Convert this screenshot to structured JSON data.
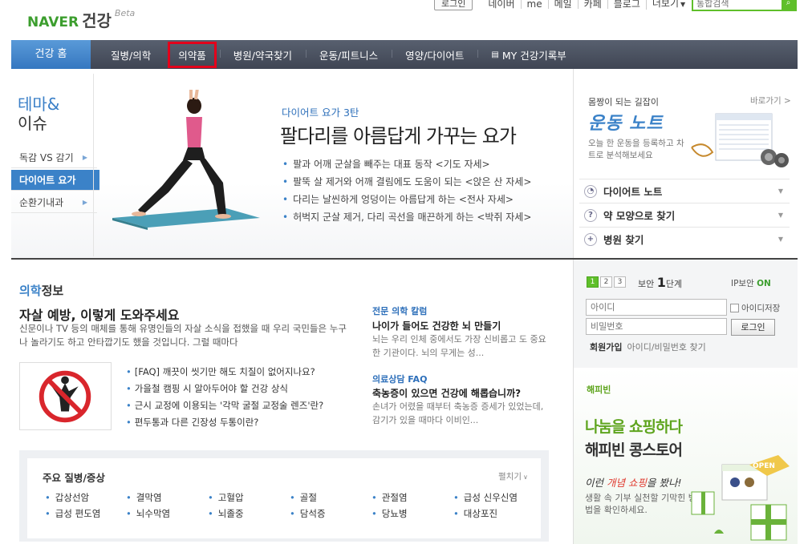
{
  "header": {
    "logo_naver": "NAVER",
    "logo_service": "건강",
    "logo_beta": "Beta",
    "login_button": "로그인",
    "top_links": [
      "네이버",
      "me",
      "메일",
      "카페",
      "블로그",
      "더보기"
    ],
    "search_placeholder": "통합검색"
  },
  "gnb": {
    "home": "건강 홈",
    "items": [
      "질병/의학",
      "의약품",
      "병원/약국찾기",
      "운동/피트니스",
      "영양/다이어트",
      "MY 건강기록부"
    ],
    "selected": "의약품"
  },
  "theme": {
    "title_line1": "테마&",
    "title_line2": "이슈",
    "menu": [
      "독감 VS 감기",
      "다이어트 요가",
      "순환기내과"
    ],
    "active_menu": "다이어트 요가",
    "subtitle": "다이어트 요가 3탄",
    "headline": "팔다리를 아름답게 가꾸는 요가",
    "bullets": [
      "팔과 어깨 군살을 빼주는 대표 동작 <기도 자세>",
      "팔뚝 살 제거와 어깨 결림에도 도움이 되는 <앉은 산 자세>",
      "다리는 날씬하게 엉덩이는 아름답게 하는 <전사 자세>",
      "허벅지 군살 제거, 다리 곡선을 매끈하게 하는 <박쥐 자세>"
    ]
  },
  "exercise_note": {
    "line1": "몸짱이 되는 길잡이",
    "title": "운동 노트",
    "desc": "오늘 한 운동을 등록하고 차트로 분석해보세요",
    "more": "바로가기 >",
    "rows": [
      "다이어트 노트",
      "약 모양으로 찾기",
      "병원 찾기"
    ]
  },
  "medical": {
    "title_highlight": "의학",
    "title_rest": "정보",
    "headline": "자살 예방, 이렇게 도와주세요",
    "desc": "신문이나 TV 등의 매체를 통해 유명인들의 자살 소식을 접했을 때 우리 국민들은 누구나 놀라기도 하고 안타깝기도 했을 것입니다. 그럴 때마다",
    "links": [
      "[FAQ] 깨끗이 씻기만 해도 치질이 없어지나요?",
      "가을철 캠핑 시 알아두어야 할 건강 상식",
      "근시 교정에 이용되는 '각막 굴절 교정술 렌즈'란?",
      "편두통과 다른 긴장성 두통이란?"
    ],
    "column_label": "전문 의학 칼럼",
    "column_head": "나이가 들어도 건강한 뇌 만들기",
    "column_desc": "뇌는 우리 인체 중에서도 가장 신비롭고 도 중요한 기관이다. 뇌의 무게는 성...",
    "faq_label": "의료상담 FAQ",
    "faq_head": "축농증이 있으면 건강에 해롭습니까?",
    "faq_desc": "손녀가 어렸을 때부터 축농증 증세가 있었는데, 감기가 있을 때마다 이비인..."
  },
  "diseases": {
    "title": "주요 질병/증상",
    "more": "펼치기",
    "row1": [
      "갑상선암",
      "결막염",
      "고혈압",
      "골절",
      "관절염",
      "급성 신우신염"
    ],
    "row2": [
      "급성 편도염",
      "뇌수막염",
      "뇌졸중",
      "담석증",
      "당뇨병",
      "대상포진"
    ]
  },
  "login": {
    "security_tabs": [
      "1",
      "2",
      "3"
    ],
    "security_label": "보안",
    "security_level": "1",
    "security_unit": "단계",
    "ip_label": "IP보안",
    "ip_state": "ON",
    "id_placeholder": "아이디",
    "pw_placeholder": "비밀번호",
    "save_id": "아이디저장",
    "login_button": "로그인",
    "join": "회원가입",
    "find": "아이디/비밀번호 찾기"
  },
  "happybean": {
    "logo": "해피빈",
    "line1": "나눔을 쇼핑하다",
    "line2": "해피빈 콩스토어",
    "line3_a": "이런 ",
    "line3_b": "개념 쇼핑",
    "line3_c": "을 봤나!",
    "line4": "생활 속 기부 실천할 기막힌 방법을 확인하세요.",
    "badge": "OPEN"
  },
  "colors": {
    "naver_green": "#3c9e2e",
    "gnb_blue": "#3577c0",
    "highlight_red": "#e3001b"
  }
}
